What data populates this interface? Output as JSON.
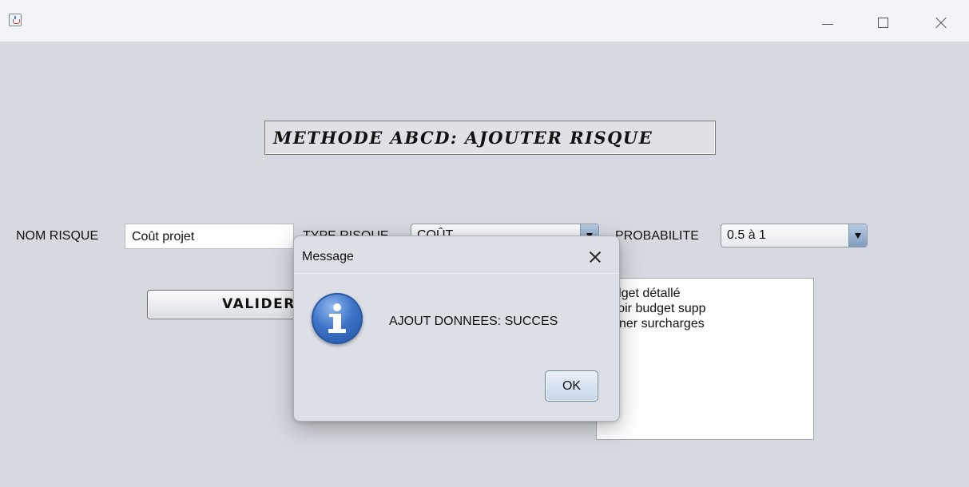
{
  "window": {
    "title_icon": "java-coffee-icon",
    "controls": [
      "minimize-icon",
      "maximize-icon",
      "close-icon"
    ]
  },
  "form": {
    "title": "METHODE ABCD: AJOUTER RISQUE",
    "nom_label": "NOM RISQUE",
    "nom_value": "Coût projet",
    "type_label": "TYPE RISQUE",
    "type_value": "COÛT",
    "prob_label": "PROBABILITE",
    "prob_value": "0.5 à 1",
    "submit_label": "VALIDER",
    "actions_lines": [
      "budget détallé",
      "révoir budget supp",
      "liminer surcharges"
    ]
  },
  "dialog": {
    "title": "Message",
    "message": "AJOUT DONNEES: SUCCES",
    "ok_label": "OK",
    "icon": "info-icon"
  },
  "colors": {
    "background": "#d6d9e0",
    "titlebar": "#f2f4f7",
    "combo_arrow": "#7e9bbd",
    "info_icon": "#3d74c8"
  }
}
